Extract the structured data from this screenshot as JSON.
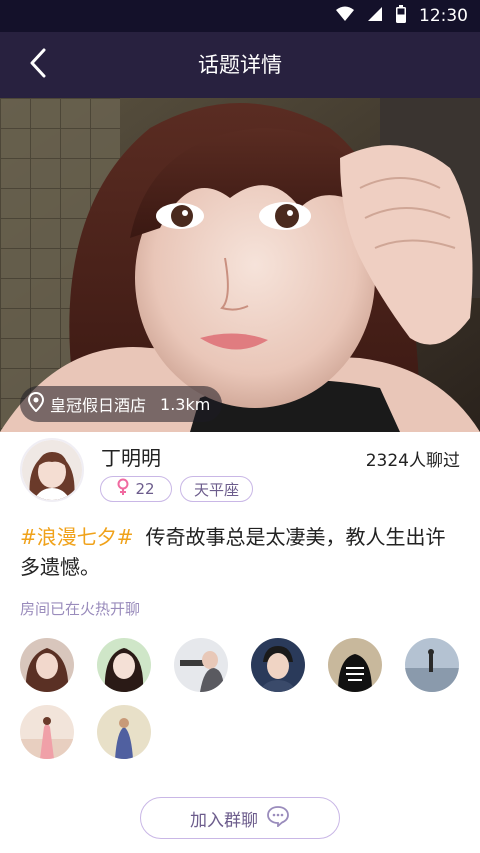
{
  "status_bar": {
    "time": "12:30",
    "icons": [
      "wifi-icon",
      "signal-icon",
      "battery-icon"
    ]
  },
  "nav": {
    "title": "话题详情",
    "back_icon": "chevron-left-icon"
  },
  "hero": {
    "location": "皇冠假日酒店",
    "distance": "1.3km",
    "location_icon": "map-pin-icon"
  },
  "user": {
    "name": "丁明明",
    "chat_count": "2324人聊过",
    "age": "22",
    "gender_icon": "female-icon",
    "zodiac": "天平座"
  },
  "topic": {
    "hashtag": "#浪漫七夕#",
    "text": "传奇故事总是太凄美，教人生出许多遗憾。"
  },
  "rooms": {
    "label": "房间已在火热开聊"
  },
  "join": {
    "label": "加入群聊",
    "icon": "chat-bubble-icon"
  },
  "colors": {
    "status_bar": "#14112a",
    "nav_bar": "#28213f",
    "accent": "#f0a21a",
    "tag_border": "#c9b7e6",
    "muted_purple": "#9a8cbc",
    "female_pink": "#f06aa0"
  }
}
